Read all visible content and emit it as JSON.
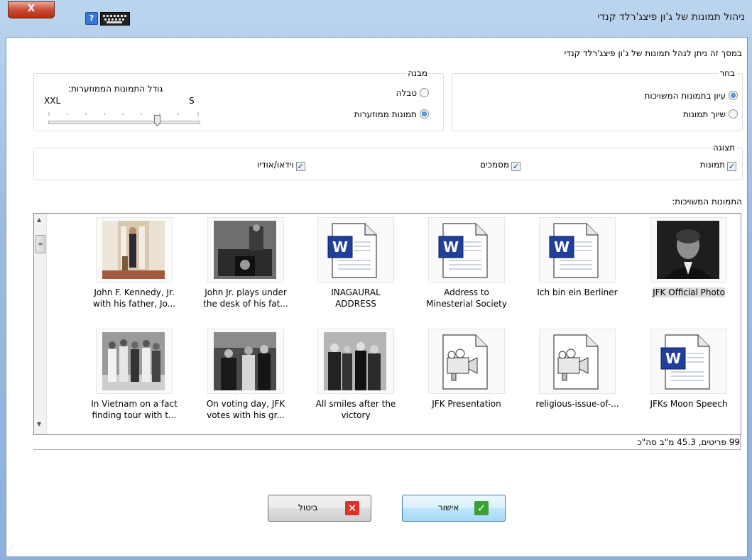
{
  "window": {
    "title": "ניהול תמונות של ג'ון פיצג'רלד קנדי",
    "close_label": "X",
    "help_label": "?"
  },
  "intro": "במסך זה ניתן לנהל תמונות של ג'ון פיצג'רלד קנדי",
  "choose_group": {
    "legend": "בחר",
    "options": [
      "עיון בתמונות המשויכות",
      "שיוך תמונות"
    ],
    "selected": 0
  },
  "structure_group": {
    "legend": "מבנה",
    "options": [
      "טבלה",
      "תמונות ממוזערות"
    ],
    "selected": 1,
    "thumb_size_label": "גודל התמונות הממוזערות:",
    "slider_min": "S",
    "slider_max": "XXL",
    "slider_level": 0.72
  },
  "display_group": {
    "legend": "תצוגה",
    "checks": [
      {
        "label": "תמונות",
        "checked": true
      },
      {
        "label": "מסמכים",
        "checked": true
      },
      {
        "label": "וידאו/אודיו",
        "checked": true
      }
    ]
  },
  "list_label": "התמונות המשויכות:",
  "items": [
    {
      "kind": "photo-portrait",
      "line1": "JFK Official Photo",
      "line2": "",
      "selected": true
    },
    {
      "kind": "word",
      "line1": "Ich bin ein Berliner",
      "line2": ""
    },
    {
      "kind": "word",
      "line1": "Address to",
      "line2": "Minesterial Society"
    },
    {
      "kind": "word",
      "line1": "INAGAURAL",
      "line2": "ADDRESS"
    },
    {
      "kind": "photo-desk",
      "line1": "John Jr. plays under",
      "line2": "the desk of his fat..."
    },
    {
      "kind": "photo-color",
      "line1": "John F. Kennedy, Jr.",
      "line2": "with his father, Jo..."
    },
    {
      "kind": "word",
      "line1": "JFKs Moon Speech",
      "line2": ""
    },
    {
      "kind": "video",
      "line1": "religious-issue-of-...",
      "line2": ""
    },
    {
      "kind": "video",
      "line1": "JFK Presentation",
      "line2": ""
    },
    {
      "kind": "photo-group",
      "line1": "All smiles after the",
      "line2": "victory"
    },
    {
      "kind": "photo-vote",
      "line1": "On voting day, JFK",
      "line2": "votes with his gr..."
    },
    {
      "kind": "photo-walk",
      "line1": "In Vietnam on a fact",
      "line2": "finding tour with t..."
    }
  ],
  "status_text": "99 פריטים, 45.3 מ\"ב סה\"כ",
  "buttons": {
    "ok_label": "אישור",
    "cancel_label": "ביטול"
  },
  "colors": {
    "ok_icon": "#3aa136",
    "cancel_icon": "#d8342a",
    "word_blue": "#1f3f9a"
  }
}
